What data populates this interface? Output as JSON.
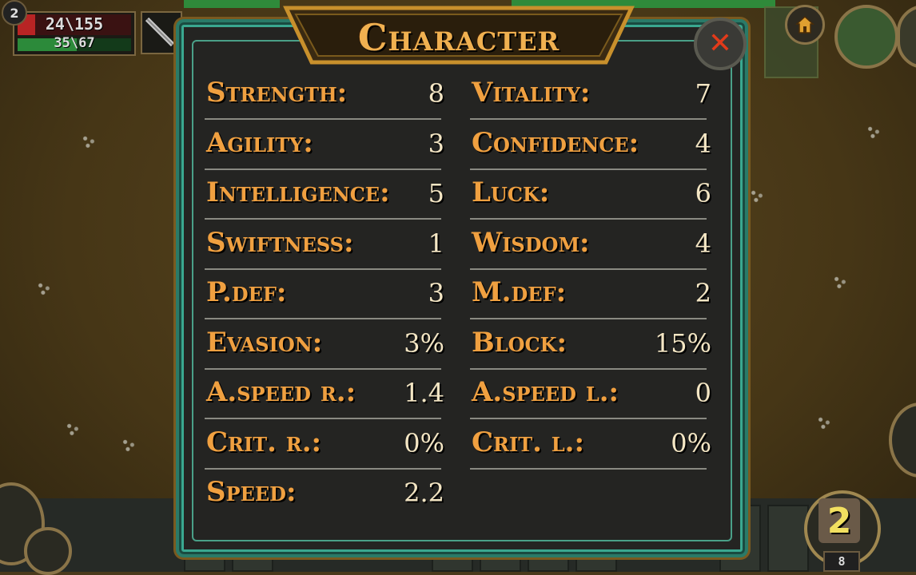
{
  "hud": {
    "level": "2",
    "hp": "24\\155",
    "hp_fraction": 0.155,
    "mp": "35\\67",
    "mp_fraction": 0.52,
    "weapon_icon": "sword-icon",
    "home_icon": "home-icon"
  },
  "panel": {
    "title": "Character",
    "close_label": "✕",
    "colors": {
      "label": "#f0a040",
      "value": "#f4e6c4",
      "border": "#2a7a68"
    },
    "stats": [
      {
        "label": "Strength:",
        "value": "8"
      },
      {
        "label": "Vitality:",
        "value": "7"
      },
      {
        "label": "Agility:",
        "value": "3"
      },
      {
        "label": "Confidence:",
        "value": "4"
      },
      {
        "label": "Intelligence:",
        "value": "5"
      },
      {
        "label": "Luck:",
        "value": "6"
      },
      {
        "label": "Swiftness:",
        "value": "1"
      },
      {
        "label": "Wisdom:",
        "value": "4"
      },
      {
        "label": "P.def:",
        "value": "3"
      },
      {
        "label": "M.def:",
        "value": "2"
      },
      {
        "label": "Evasion:",
        "value": "3%"
      },
      {
        "label": "Block:",
        "value": "15%"
      },
      {
        "label": "A.speed r.:",
        "value": "1.4"
      },
      {
        "label": "A.speed l.:",
        "value": "0"
      },
      {
        "label": "Crit. r.:",
        "value": "0%"
      },
      {
        "label": "Crit. l.:",
        "value": "0%"
      },
      {
        "label": "Speed:",
        "value": "2.2"
      }
    ]
  },
  "quick_slot": {
    "count_badge": "2",
    "slot_number": "8"
  }
}
